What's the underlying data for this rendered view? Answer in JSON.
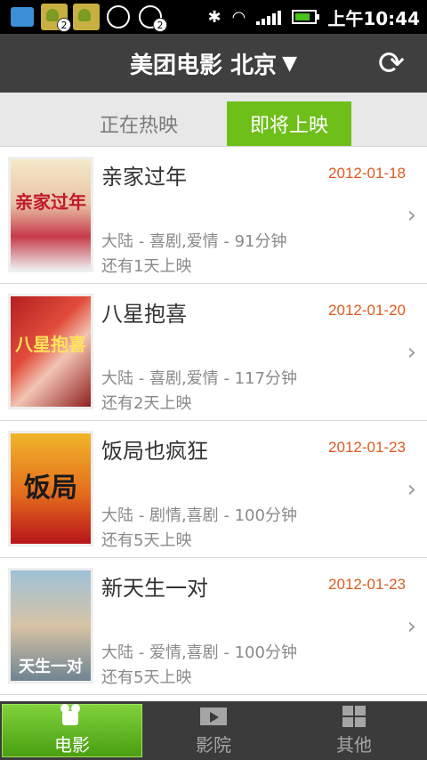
{
  "status_bar": {
    "badge_1": "2",
    "badge_2": "2",
    "time": "上午10:44"
  },
  "header": {
    "title": "美团电影 北京",
    "caret": "▼",
    "refresh_icon": "⟳"
  },
  "tabs": [
    {
      "label": "正在热映",
      "active": false
    },
    {
      "label": "即将上映",
      "active": true
    }
  ],
  "movies": [
    {
      "title": "亲家过年",
      "date": "2012-01-18",
      "meta": "大陆 - 喜剧,爱情 - 91分钟",
      "countdown": "还有1天上映",
      "poster_text": "亲家过年"
    },
    {
      "title": "八星抱喜",
      "date": "2012-01-20",
      "meta": "大陆 - 喜剧,爱情 - 117分钟",
      "countdown": "还有2天上映",
      "poster_text": "八星抱喜"
    },
    {
      "title": "饭局也疯狂",
      "date": "2012-01-23",
      "meta": "大陆 - 剧情,喜剧 - 100分钟",
      "countdown": "还有5天上映",
      "poster_text": "饭局"
    },
    {
      "title": "新天生一对",
      "date": "2012-01-23",
      "meta": "大陆 - 爱情,喜剧 - 100分钟",
      "countdown": "还有5天上映",
      "poster_text": "天生一对"
    }
  ],
  "chevron": "›",
  "bottom_nav": [
    {
      "label": "电影",
      "icon": "movie-camera-icon",
      "active": true
    },
    {
      "label": "影院",
      "icon": "cinema-screen-icon",
      "active": false
    },
    {
      "label": "其他",
      "icon": "grid-icon",
      "active": false
    }
  ],
  "colors": {
    "accent_green": "#6fbf1b",
    "date_orange": "#e05a1e",
    "titlebar": "#3f3f3f"
  }
}
